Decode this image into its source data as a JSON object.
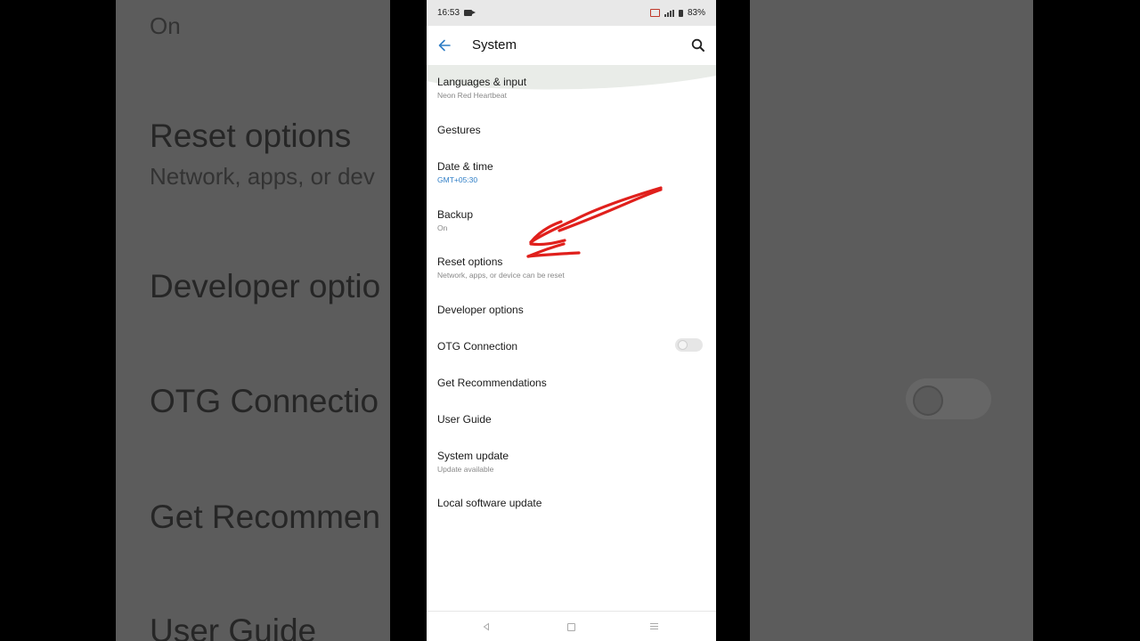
{
  "background": {
    "left_items": [
      {
        "title": "",
        "sub": "On"
      },
      {
        "title": "Reset options",
        "sub": "Network, apps, or dev"
      },
      {
        "title": "Developer optio",
        "sub": ""
      },
      {
        "title": "OTG Connectio",
        "sub": ""
      },
      {
        "title": "Get Recommen",
        "sub": ""
      },
      {
        "title": "User Guide",
        "sub": ""
      }
    ]
  },
  "status_bar": {
    "time": "16:53",
    "battery": "83%"
  },
  "app_bar": {
    "title": "System",
    "back_icon": "arrow-left-icon",
    "search_icon": "search-icon"
  },
  "items": [
    {
      "title": "Languages & input",
      "sub": "Neon Red Heartbeat"
    },
    {
      "title": "Gestures",
      "sub": ""
    },
    {
      "title": "Date & time",
      "sub": "GMT+05:30"
    },
    {
      "title": "Backup",
      "sub": "On"
    },
    {
      "title": "Reset options",
      "sub": "Network, apps, or device can be reset"
    },
    {
      "title": "Developer options",
      "sub": ""
    },
    {
      "title": "OTG Connection",
      "sub": ""
    },
    {
      "title": "Get Recommendations",
      "sub": ""
    },
    {
      "title": "User Guide",
      "sub": ""
    },
    {
      "title": "System update",
      "sub": "Update available"
    },
    {
      "title": "Local software update",
      "sub": ""
    }
  ],
  "otg_toggle": {
    "on": false
  },
  "colors": {
    "accent": "#2f7ec6",
    "annotation": "#e0201c"
  }
}
